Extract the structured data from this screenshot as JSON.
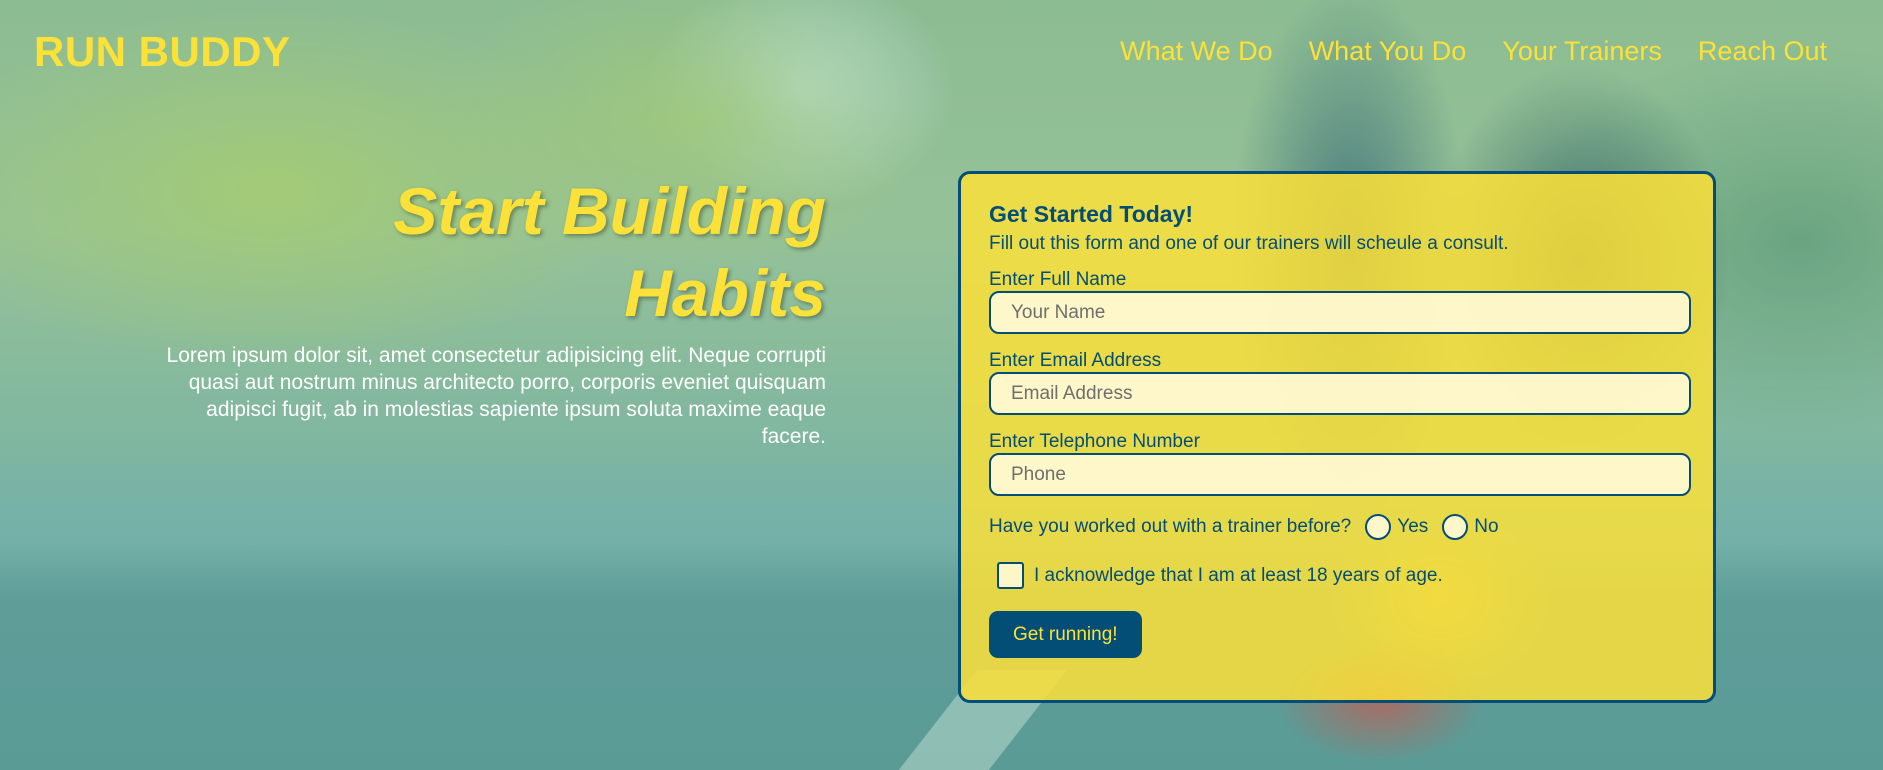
{
  "header": {
    "logo": "RUN BUDDY",
    "nav": [
      {
        "label": "What We Do"
      },
      {
        "label": "What You Do"
      },
      {
        "label": "Your Trainers"
      },
      {
        "label": "Reach Out"
      }
    ]
  },
  "hero": {
    "title_line1": "Start Building",
    "title_line2": "Habits",
    "text": "Lorem ipsum dolor sit, amet consectetur adipisicing elit. Neque corrupti quasi aut nostrum minus architecto porro, corporis eveniet quisquam adipisci fugit, ab in molestias sapiente ipsum soluta maxime eaque facere."
  },
  "form": {
    "heading": "Get Started Today!",
    "subtext": "Fill out this form and one of our trainers will scheule a consult.",
    "name_label": "Enter Full Name",
    "name_placeholder": "Your Name",
    "email_label": "Enter Email Address",
    "email_placeholder": "Email Address",
    "phone_label": "Enter Telephone Number",
    "phone_placeholder": "Phone",
    "trainer_question": "Have you worked out with a trainer before?",
    "yes_label": "Yes",
    "no_label": "No",
    "age_ack": "I acknowledge that I am at least 18 years of age.",
    "submit_label": "Get running!"
  },
  "colors": {
    "brand_yellow": "#fce138",
    "brand_blue": "#024e76"
  }
}
